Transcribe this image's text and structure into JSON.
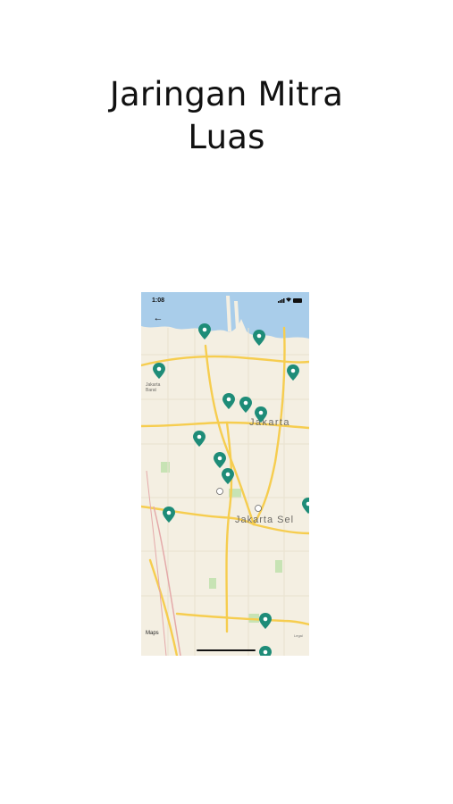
{
  "headline": {
    "line1": "Jaringan Mitra",
    "line2": "Luas"
  },
  "phone": {
    "status_time": "1:08",
    "back_icon": "arrow-left-icon",
    "map_labels": {
      "city": "Jakarta",
      "south": "Jakarta Sel",
      "west_line1": "Jakarta",
      "west_line2": "Barat",
      "attribution": "Maps",
      "legal": "Legal"
    },
    "pin_color": "#1e8c78",
    "pin_count": 14
  },
  "colors": {
    "water": "#a9cdea",
    "land": "#f4efe2",
    "highway": "#f6cd4f",
    "park": "#c7e3b4"
  }
}
